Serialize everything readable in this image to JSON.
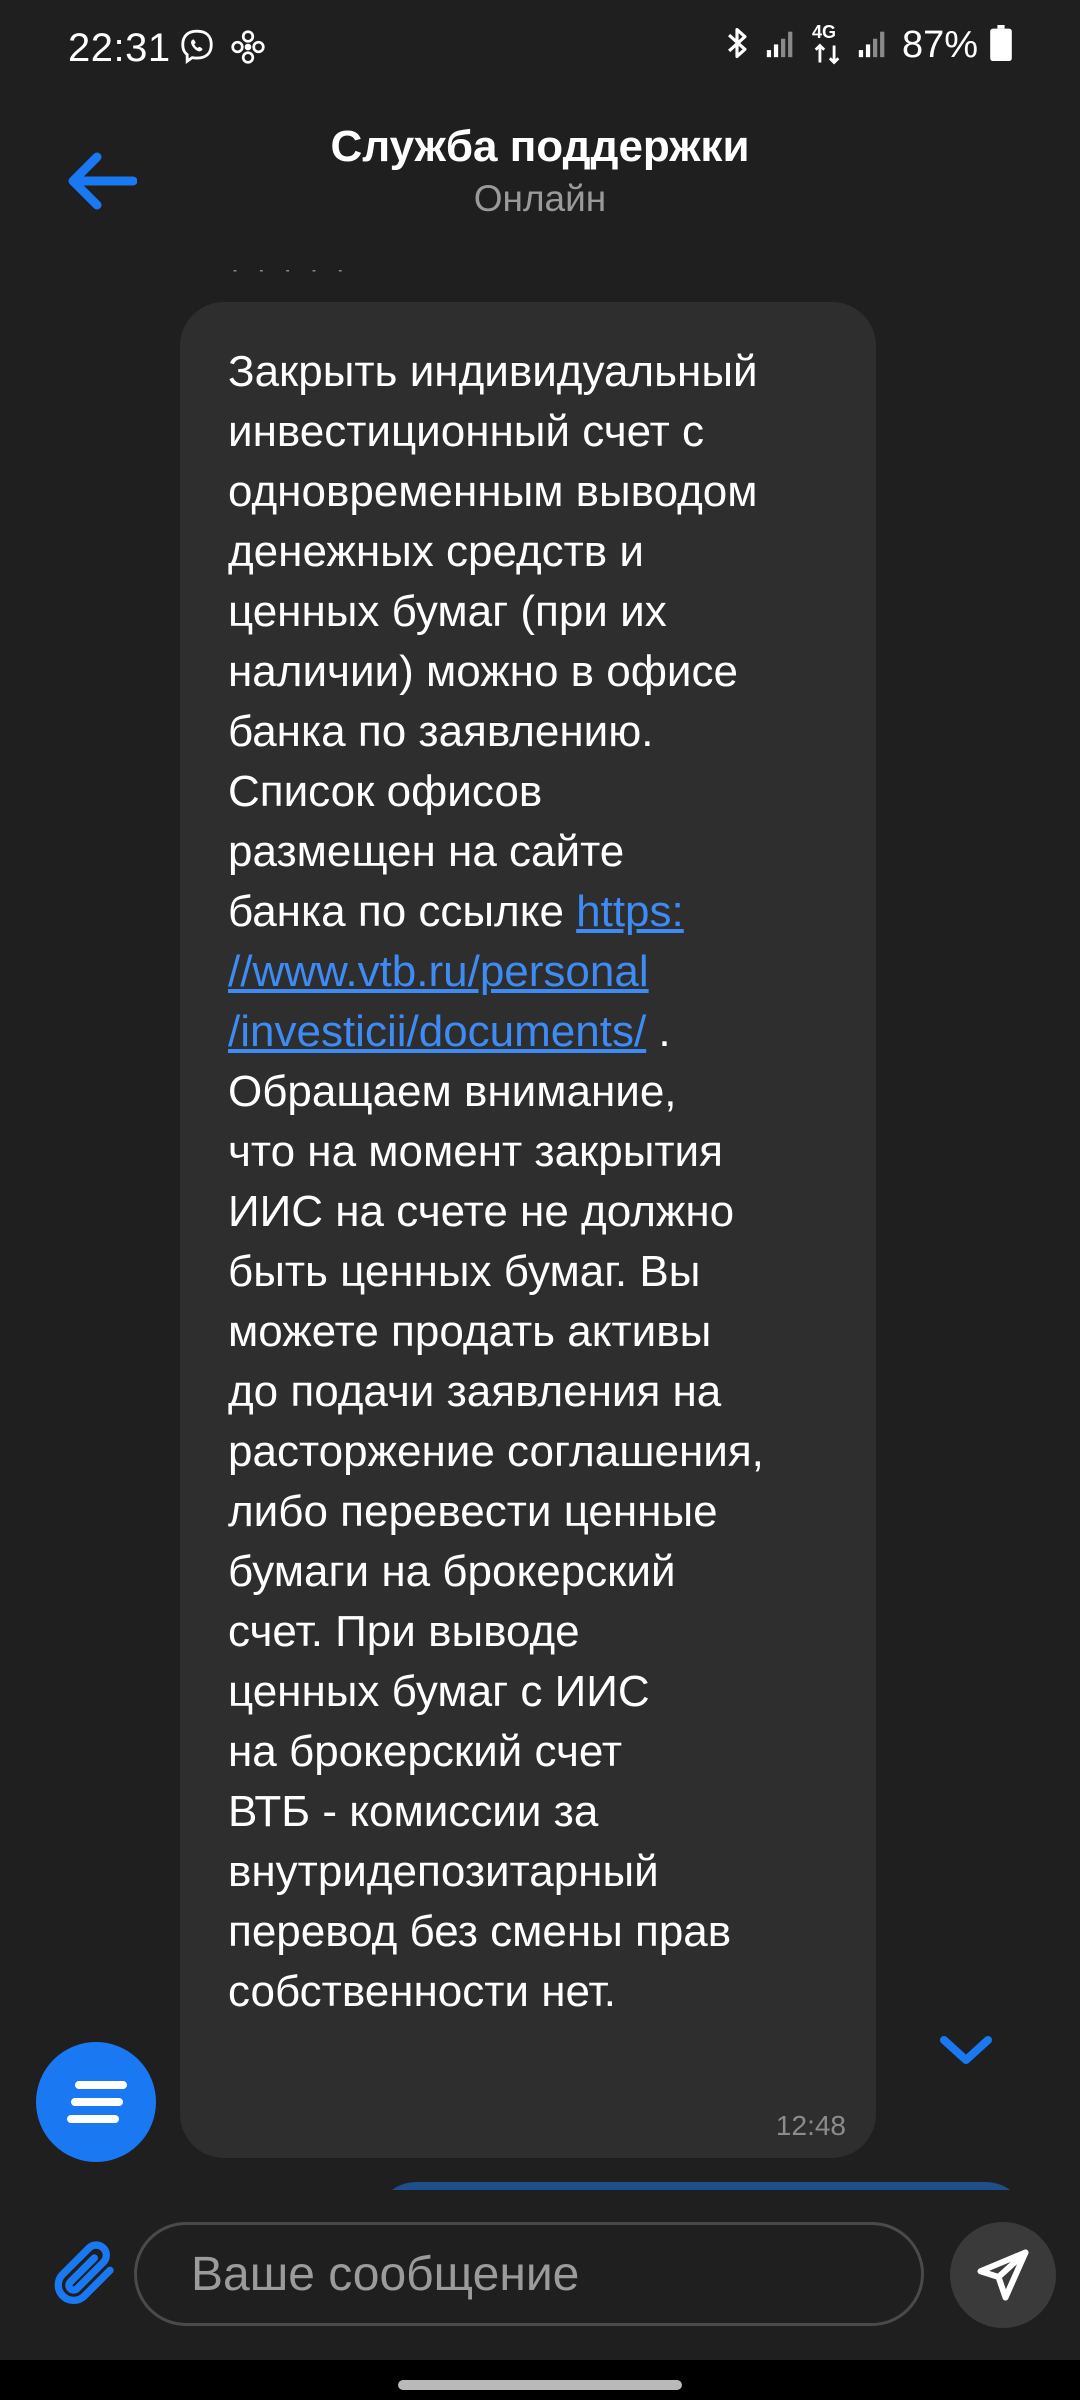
{
  "status_bar": {
    "time": "22:31",
    "battery_percent": "87%",
    "network_label": "4G",
    "icons": [
      "viber-icon",
      "pinwheel-icon",
      "bluetooth-icon",
      "signal-icon",
      "data-arrows-icon",
      "battery-icon"
    ]
  },
  "header": {
    "title": "Служба поддержки",
    "subtitle": "Онлайн"
  },
  "chat": {
    "message": {
      "text_before_link": "Закрыть индивидуальный\nинвестиционный счет с\nодновременным выводом\nденежных средств и\nценных бумаг (при их\nналичии) можно в офисе\nбанка по заявлению.\nСписок офисов\nразмещен на сайте\nбанка по ссылке ",
      "link": "https:\n//www.vtb.ru/personal\n/investicii/documents/",
      "text_after_link": " .\nОбращаем внимание,\nчто на момент закрытия\nИИС на счете не должно\nбыть ценных бумаг. Вы\nможете продать активы\nдо подачи заявления на\nрасторжение соглашения,\nлибо перевести ценные\nбумаги на брокерский\nсчет. При выводе\nценных бумаг с ИИС\nна брокерский счет\nВТБ - комиссии за\nвнутридепозитарный\nперевод без смены прав\nсобственности нет.",
      "time": "12:48"
    }
  },
  "input": {
    "placeholder": "Ваше сообщение",
    "value": ""
  },
  "colors": {
    "background": "#1f1f1f",
    "bubble_incoming": "#2e2e2e",
    "accent": "#1a78f2",
    "link": "#3d8bf5",
    "outgoing_bubble": "#1e4e8c"
  }
}
